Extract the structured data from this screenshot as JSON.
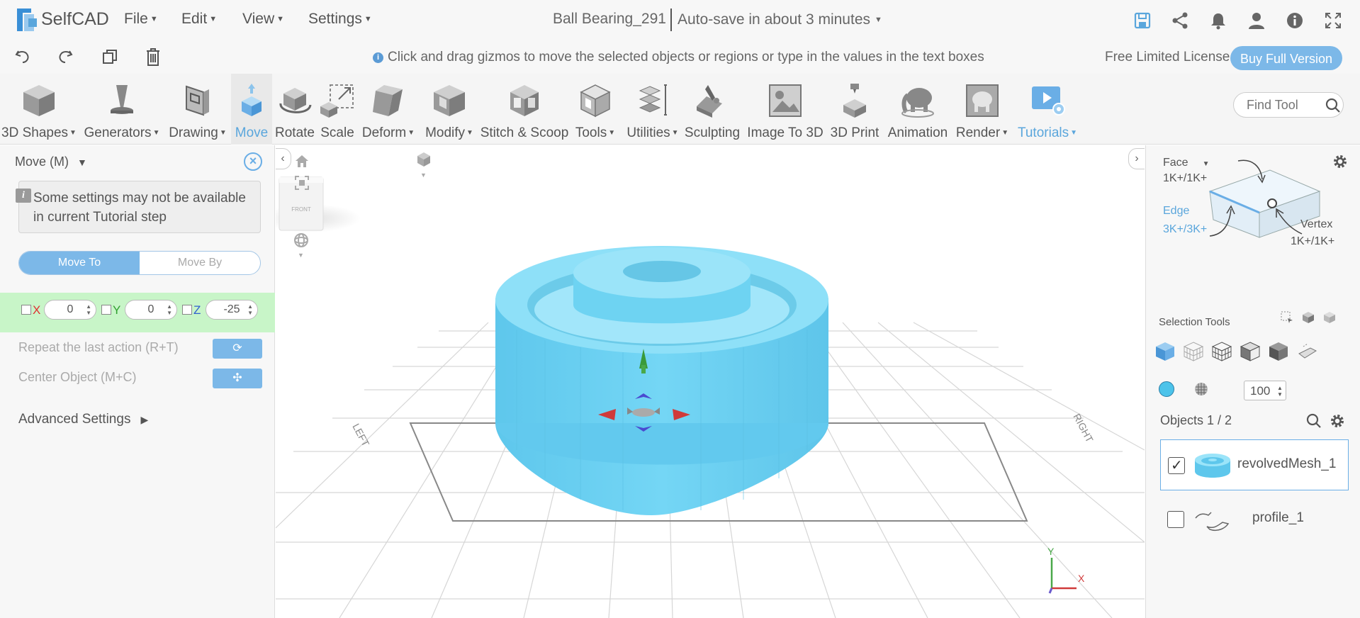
{
  "app": {
    "name": "SelfCAD"
  },
  "menus": [
    {
      "label": "File"
    },
    {
      "label": "Edit"
    },
    {
      "label": "View"
    },
    {
      "label": "Settings"
    }
  ],
  "document": {
    "title": "Ball Bearing_291",
    "autosave": "Auto-save in about 3 minutes"
  },
  "topbar_icons": [
    "save-icon",
    "share-icon",
    "bell-icon",
    "user-icon",
    "info-icon",
    "fullscreen-icon"
  ],
  "hint": {
    "text": "Click and drag gizmos to move the selected objects or regions or type in the values in the text boxes"
  },
  "license": {
    "text": "Free Limited License",
    "buy_label": "Buy Full Version"
  },
  "toolbar": {
    "tools": [
      {
        "label": "3D Shapes",
        "dropdown": true
      },
      {
        "label": "Generators",
        "dropdown": true
      },
      {
        "label": "Drawing",
        "dropdown": true
      },
      {
        "label": "Move",
        "dropdown": false,
        "active": true
      },
      {
        "label": "Rotate",
        "dropdown": false
      },
      {
        "label": "Scale",
        "dropdown": false
      },
      {
        "label": "Deform",
        "dropdown": true
      },
      {
        "label": "Modify",
        "dropdown": true
      },
      {
        "label": "Stitch & Scoop",
        "dropdown": false
      },
      {
        "label": "Tools",
        "dropdown": true
      },
      {
        "label": "Utilities",
        "dropdown": true
      },
      {
        "label": "Sculpting",
        "dropdown": false
      },
      {
        "label": "Image To 3D",
        "dropdown": false
      },
      {
        "label": "3D Print",
        "dropdown": false
      },
      {
        "label": "Animation",
        "dropdown": false
      },
      {
        "label": "Render",
        "dropdown": true
      },
      {
        "label": "Tutorials",
        "dropdown": true
      }
    ],
    "find_placeholder": "Find Tool"
  },
  "move_panel": {
    "title": "Move (M)",
    "note": "Some settings may not be available in current Tutorial step",
    "mode_move_to": "Move To",
    "mode_move_by": "Move By",
    "x_label": "X",
    "y_label": "Y",
    "z_label": "Z",
    "x_value": "0",
    "y_value": "0",
    "z_value": "-25",
    "repeat_label": "Repeat the last action (R+T)",
    "center_label": "Center Object (M+C)",
    "advanced_label": "Advanced Settings"
  },
  "viewport": {
    "view_cube_label": "FRONT",
    "left_label": "LEFT",
    "right_label": "RIGHT",
    "axis_x": "X",
    "axis_y": "Y",
    "colors": {
      "object": "#6ed3f2",
      "grid": "#d8d8d8",
      "x_axis": "#e04040",
      "y_axis": "#40b040",
      "z_axis": "#6a5acd"
    }
  },
  "selection_panel": {
    "face_label": "Face",
    "face_count": "1K+/1K+",
    "edge_label": "Edge",
    "edge_count": "3K+/3K+",
    "vertex_label": "Vertex",
    "vertex_count": "1K+/1K+",
    "tools_label": "Selection Tools",
    "brush_value": "100",
    "objects_label": "Objects 1 / 2",
    "objects": [
      {
        "name": "revolvedMesh_1",
        "checked": true,
        "selected": true
      },
      {
        "name": "profile_1",
        "checked": false,
        "selected": false
      }
    ]
  }
}
